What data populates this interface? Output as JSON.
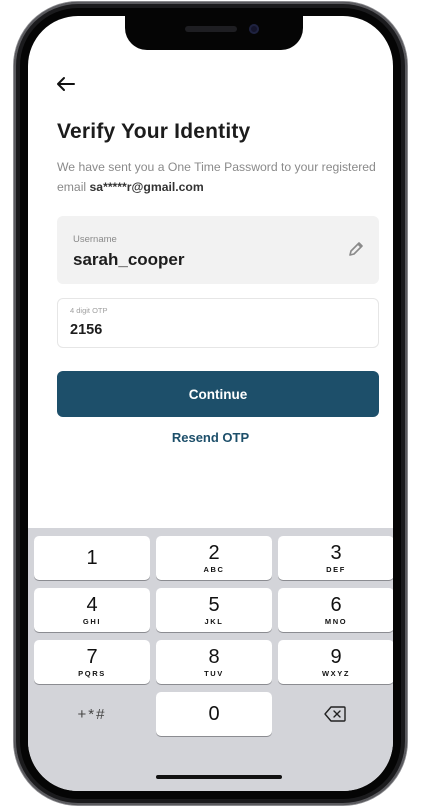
{
  "header": {
    "back_icon": "arrow-left-icon",
    "title": "Verify Your Identity",
    "subtitle_text": "We have sent you a One Time Password to your registered email ",
    "subtitle_email": "sa*****r@gmail.com"
  },
  "username": {
    "label": "Username",
    "value": "sarah_cooper",
    "edit_icon": "pencil-icon"
  },
  "otp": {
    "label": "4 digit OTP",
    "value": "2156"
  },
  "continue_label": "Continue",
  "resend_label": "Resend OTP",
  "keypad": {
    "keys": [
      {
        "num": "1",
        "letters": ""
      },
      {
        "num": "2",
        "letters": "ABC"
      },
      {
        "num": "3",
        "letters": "DEF"
      },
      {
        "num": "4",
        "letters": "GHI"
      },
      {
        "num": "5",
        "letters": "JKL"
      },
      {
        "num": "6",
        "letters": "MNO"
      },
      {
        "num": "7",
        "letters": "PQRS"
      },
      {
        "num": "8",
        "letters": "TUV"
      },
      {
        "num": "9",
        "letters": "WXYZ"
      }
    ],
    "symbols": "+*#",
    "zero": "0",
    "delete_icon": "backspace-icon"
  },
  "colors": {
    "primary": "#1d4f6a",
    "keypad_bg": "#d3d4d9"
  }
}
